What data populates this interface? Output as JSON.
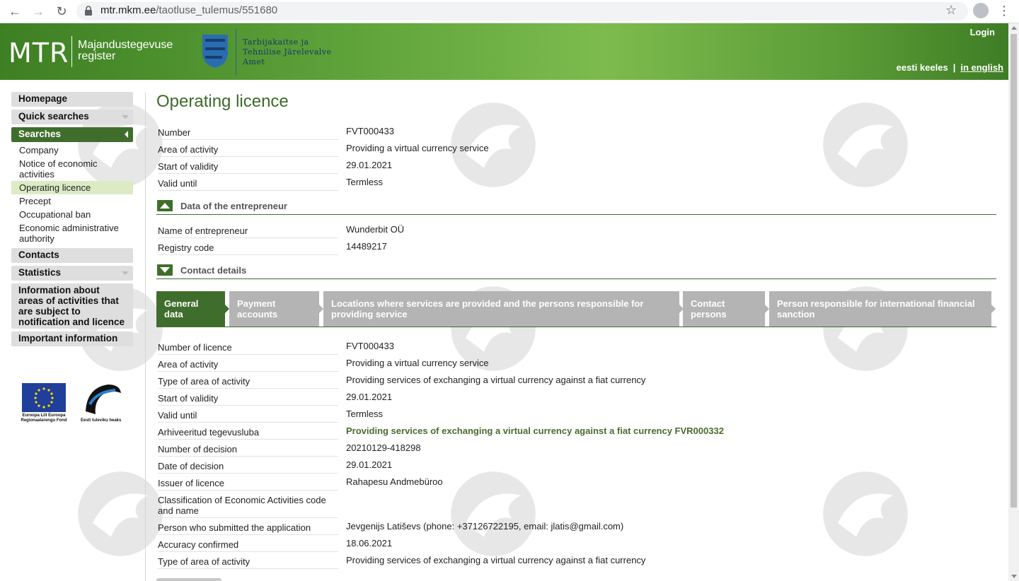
{
  "browser": {
    "url_host": "mtr.mkm.ee",
    "url_path": "/taotluse_tulemus/551680"
  },
  "header": {
    "logo": "MTR",
    "logo_subtitle_line1": "Majandustegevuse",
    "logo_subtitle_line2": "register",
    "agency_line1": "Tarbijakaitse ja",
    "agency_line2": "Tehnilise Järelevalve",
    "agency_line3": "Amet",
    "login": "Login",
    "lang_et": "eesti keeles",
    "lang_sep": "|",
    "lang_en": "in english"
  },
  "sidebar": {
    "homepage": "Homepage",
    "quick_searches": "Quick searches",
    "searches": "Searches",
    "sub": {
      "company": "Company",
      "notice": "Notice of economic activities",
      "operating_licence": "Operating licence",
      "precept": "Precept",
      "occupational_ban": "Occupational ban",
      "economic_authority": "Economic administrative authority"
    },
    "contacts": "Contacts",
    "statistics": "Statistics",
    "info_areas": "Information about areas of activities that are subject to notification and licence",
    "important_info": "Important information",
    "eu_text": "Euroopa Liit Euroopa Regionaalarengu Fond",
    "ee_text": "Eesti tuleviku heaks"
  },
  "main": {
    "title": "Operating licence",
    "summary": [
      {
        "label": "Number",
        "value": "FVT000433"
      },
      {
        "label": "Area of activity",
        "value": "Providing a virtual currency service"
      },
      {
        "label": "Start of validity",
        "value": "29.01.2021"
      },
      {
        "label": "Valid until",
        "value": "Termless"
      }
    ],
    "entrepreneur_section": "Data of the entrepreneur",
    "entrepreneur": [
      {
        "label": "Name of entrepreneur",
        "value": "Wunderbit OÜ"
      },
      {
        "label": "Registry code",
        "value": "14489217"
      }
    ],
    "contact_section": "Contact details",
    "tabs": [
      "General data",
      "Payment accounts",
      "Locations where services are provided and the persons responsible for providing service",
      "Contact persons",
      "Person responsible for international financial sanction"
    ],
    "general": [
      {
        "label": "Number of licence",
        "value": "FVT000433"
      },
      {
        "label": "Area of activity",
        "value": "Providing a virtual currency service"
      },
      {
        "label": "Type of area of activity",
        "value": "Providing services of exchanging a virtual currency against a fiat currency"
      },
      {
        "label": "Start of validity",
        "value": "29.01.2021"
      },
      {
        "label": "Valid until",
        "value": "Termless"
      },
      {
        "label": "Arhiveeritud tegevusluba",
        "value": "Providing services of exchanging a virtual currency against a fiat currency FVR000332"
      },
      {
        "label": "Number of decision",
        "value": "20210129-418298"
      },
      {
        "label": "Date of decision",
        "value": "29.01.2021"
      },
      {
        "label": "Issuer of licence",
        "value": "Rahapesu Andmebüroo"
      },
      {
        "label": "Classification of Economic Activities code and name",
        "value": ""
      },
      {
        "label": "Person who submitted the application",
        "value": "Jevgenijs Latiševs (phone: +37126722195, email: jlatis@gmail.com)"
      },
      {
        "label": "Accuracy confirmed",
        "value": "18.06.2021"
      },
      {
        "label": "Type of area of activity",
        "value": "Providing services of exchanging a virtual currency against a fiat currency"
      }
    ]
  }
}
